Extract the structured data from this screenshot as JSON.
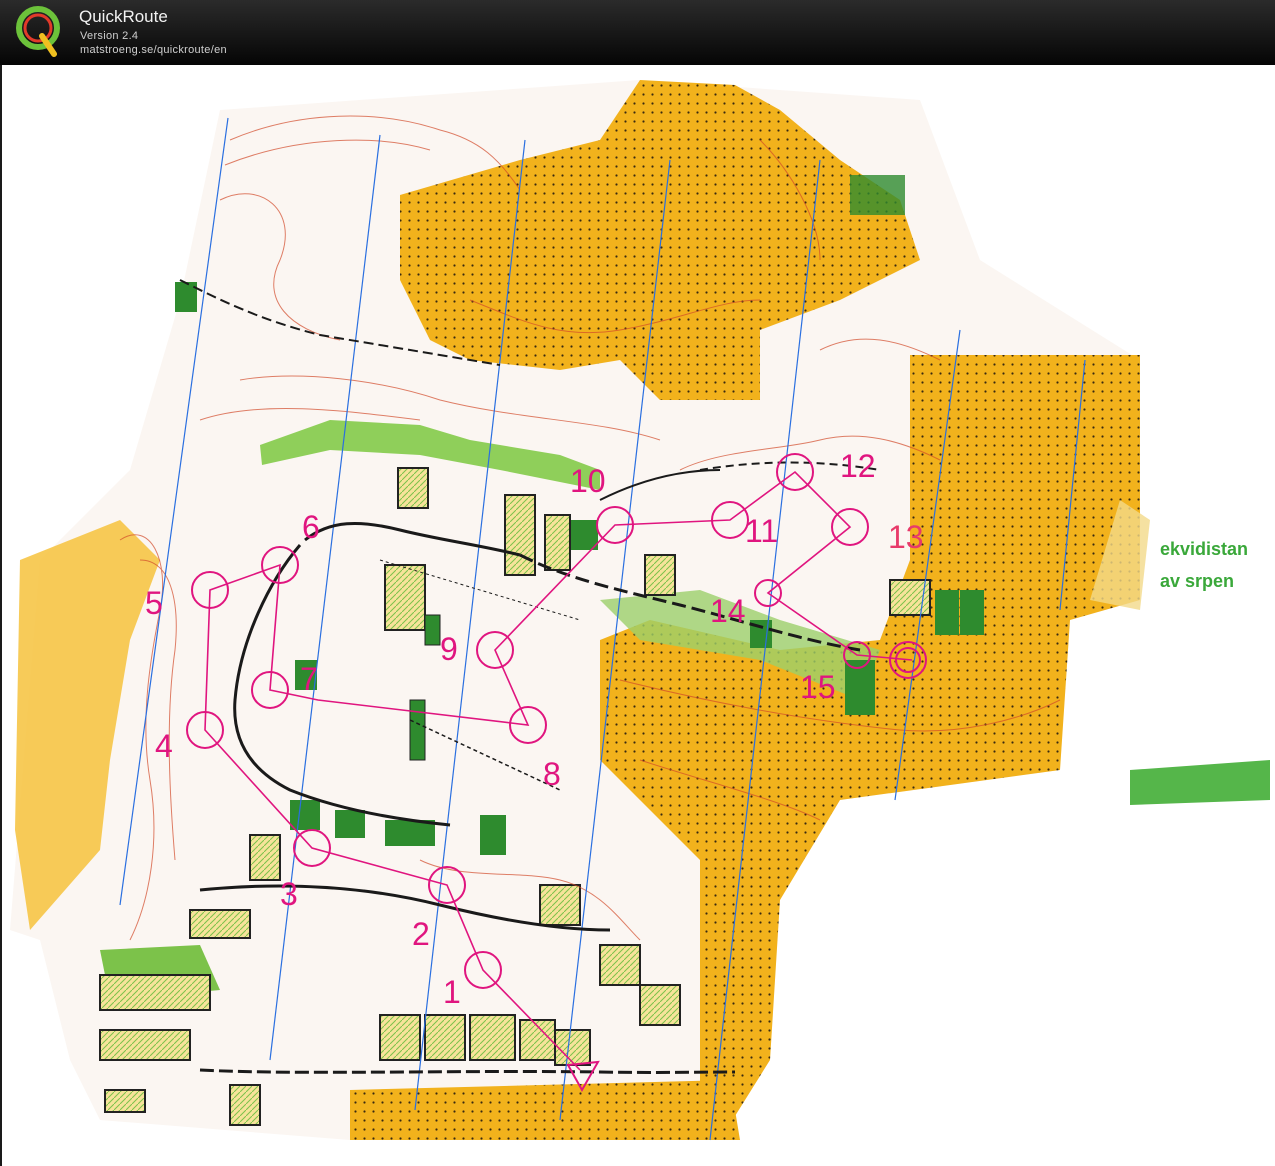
{
  "app": {
    "title": "QuickRoute",
    "version": "Version 2.4",
    "url": "matstroeng.se/quickroute/en",
    "logo_letter": "Q"
  },
  "map": {
    "controls": [
      {
        "label": "1"
      },
      {
        "label": "2"
      },
      {
        "label": "3"
      },
      {
        "label": "4"
      },
      {
        "label": "5"
      },
      {
        "label": "6"
      },
      {
        "label": "7"
      },
      {
        "label": "8"
      },
      {
        "label": "9"
      },
      {
        "label": "10"
      },
      {
        "label": "11"
      },
      {
        "label": "12"
      },
      {
        "label": "13"
      },
      {
        "label": "14"
      },
      {
        "label": "15"
      }
    ],
    "legend_fragment": [
      "ekvidistan",
      "av srpen"
    ],
    "colors": {
      "open_land": "#f2b21c",
      "rough_open": "#f7d46a",
      "forest_green": "#7cc24a",
      "dark_green": "#2e8b2e",
      "course_magenta": "#e0157f",
      "contour_brown": "#d24a2a",
      "meridian_blue": "#2a6fe0"
    }
  }
}
